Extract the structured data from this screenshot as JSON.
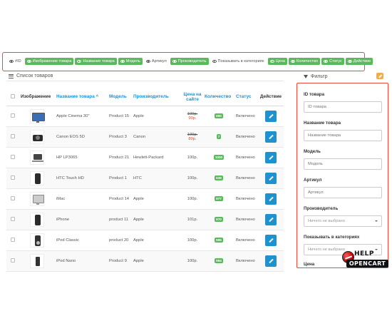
{
  "colors": {
    "accent": "#1e91cf",
    "toggle_on": "#5cb85c",
    "highlight": "#e74c3c",
    "filter_button": "#f0ad4e",
    "special_price": "#e74c3c"
  },
  "column_toggles": [
    {
      "label": "#ID",
      "enabled": false
    },
    {
      "label": "Изображение товара",
      "enabled": true
    },
    {
      "label": "Название товара",
      "enabled": true
    },
    {
      "label": "Модель",
      "enabled": true
    },
    {
      "label": "Артикул",
      "enabled": false
    },
    {
      "label": "Производитель",
      "enabled": true
    },
    {
      "label": "Показывать в категориях",
      "enabled": false
    },
    {
      "label": "Цена",
      "enabled": true
    },
    {
      "label": "Количество",
      "enabled": true
    },
    {
      "label": "Статус",
      "enabled": true
    },
    {
      "label": "Действие",
      "enabled": true
    }
  ],
  "product_list": {
    "title": "Список товаров",
    "columns": {
      "image": "Изображение",
      "name": "Название товара",
      "model": "Модель",
      "manufacturer": "Производитель",
      "price": "Цена на сайте",
      "quantity": "Количество",
      "status": "Статус",
      "action": "Действие"
    },
    "rows": [
      {
        "name": "Apple Cinema 30\"",
        "model": "Product 15",
        "manufacturer": "Apple",
        "price": "100р.",
        "special": "90р.",
        "quantity": "990",
        "status": "Включено",
        "image_icon": "monitor"
      },
      {
        "name": "Canon EOS 5D",
        "model": "Product 3",
        "manufacturer": "Canon",
        "price": "100р.",
        "special": "80р.",
        "quantity": "7",
        "status": "Включено",
        "image_icon": "camera"
      },
      {
        "name": "HP LP3065",
        "model": "Product 21",
        "manufacturer": "Hewlett-Packard",
        "price": "100р.",
        "special": "",
        "quantity": "1000",
        "status": "Включено",
        "image_icon": "laptop"
      },
      {
        "name": "HTC Touch HD",
        "model": "Product 1",
        "manufacturer": "HTC",
        "price": "100р.",
        "special": "",
        "quantity": "939",
        "status": "Включено",
        "image_icon": "phone"
      },
      {
        "name": "iMac",
        "model": "Product 14",
        "manufacturer": "Apple",
        "price": "100р.",
        "special": "",
        "quantity": "977",
        "status": "Включено",
        "image_icon": "imac"
      },
      {
        "name": "iPhone",
        "model": "product 11",
        "manufacturer": "Apple",
        "price": "101р.",
        "special": "",
        "quantity": "970",
        "status": "Включено",
        "image_icon": "phone"
      },
      {
        "name": "iPod Classic",
        "model": "product 20",
        "manufacturer": "Apple",
        "price": "100р.",
        "special": "",
        "quantity": "995",
        "status": "Включено",
        "image_icon": "ipod"
      },
      {
        "name": "iPod Nano",
        "model": "Product 9",
        "manufacturer": "Apple",
        "price": "100р.",
        "special": "",
        "quantity": "994",
        "status": "Включено",
        "image_icon": "nano"
      }
    ]
  },
  "filter": {
    "title": "Фильтр",
    "fields": [
      {
        "label": "ID товара",
        "placeholder": "ID товара",
        "type": "input"
      },
      {
        "label": "Название товара",
        "placeholder": "Название товара",
        "type": "input"
      },
      {
        "label": "Модель",
        "placeholder": "Модель",
        "type": "input"
      },
      {
        "label": "Артикул",
        "placeholder": "Артикул",
        "type": "input"
      },
      {
        "label": "Производитель",
        "placeholder": "Ничего не выбрано",
        "type": "select"
      },
      {
        "label": "Показывать в категориях",
        "placeholder": "Ничего не выбрано",
        "type": "select"
      },
      {
        "label": "Цена",
        "placeholder": "",
        "type": "label"
      }
    ]
  },
  "logo": {
    "top": "HELP",
    "bottom": "OPENCART"
  }
}
